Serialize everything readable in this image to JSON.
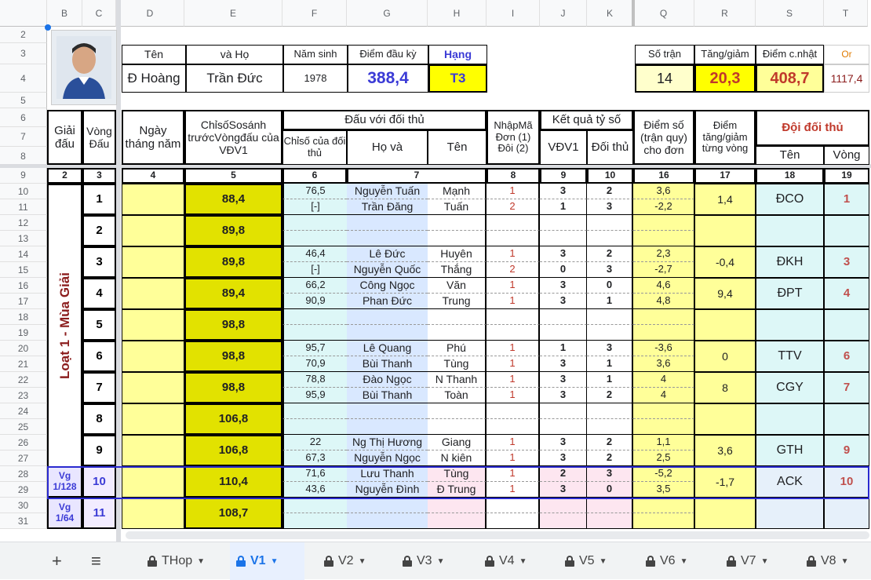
{
  "columns": [
    "B",
    "C",
    "D",
    "E",
    "F",
    "G",
    "H",
    "I",
    "J",
    "K",
    "Q",
    "R",
    "S",
    "T"
  ],
  "rows": [
    "2",
    "3",
    "4",
    "5",
    "6",
    "7",
    "8",
    "9",
    "10",
    "11",
    "12",
    "13",
    "14",
    "15",
    "16",
    "17",
    "18",
    "19",
    "20",
    "21",
    "22",
    "23",
    "24",
    "25",
    "26",
    "27",
    "28",
    "29",
    "30",
    "31"
  ],
  "profile": {
    "ten_label": "Tên",
    "va_label": "và",
    "ho_label": "Họ",
    "nam_sinh_label": "Năm sinh",
    "diem_dau_ky_label": "Điểm đầu kỳ",
    "hang_label": "Hạng",
    "ten": "Đ Hoàng",
    "ho": "Trần Đức",
    "nam_sinh": "1978",
    "diem_dau_ky": "388,4",
    "hang": "T3"
  },
  "summary": {
    "so_tran_label": "Số trận",
    "tang_giam_label": "Tăng/giảm",
    "diem_cnhat_label": "Điểm c.nhật",
    "or_label": "Or",
    "so_tran": "14",
    "tang_giam": "20,3",
    "diem_cnhat": "408,7",
    "or": "1117,4"
  },
  "headers": {
    "giai_dau": "Giải đấu",
    "vong_dau": "Vòng Đấu",
    "ngay": "Ngày tháng năm",
    "chiso": "ChỉsốSosánh trướcVòngđấu của VĐV1",
    "dau_voi": "Đấu với đối thủ",
    "chiso_doi_thu": "Chỉsố của đối thủ",
    "ho": "Họ",
    "va": "và",
    "ten": "Tên",
    "nhap_ma": "NhậpMã Đơn (1) Đôi (2)",
    "ket_qua": "Kết quả tỷ số",
    "vdv1": "VĐV1",
    "doi_thu": "Đối thủ",
    "diem_so": "Điểm số (trận quy) cho đơn",
    "diem_tang": "Điểm tăng/giảm từng vòng",
    "doi_doi_thu": "Đội đối thủ",
    "ten2": "Tên",
    "vong": "Vòng"
  },
  "col_numbers": [
    "2",
    "3",
    "4",
    "5",
    "6",
    "7",
    "8",
    "9",
    "10",
    "16",
    "17",
    "18",
    "19"
  ],
  "vertical_label": "Loạt 1 - Mùa Giải",
  "vg1": "Vg 1/128",
  "vg2": "Vg 1/64",
  "rounds": [
    {
      "vong": "1",
      "chiso": "88,4",
      "m": [
        {
          "cs": "76,5",
          "ho": "Nguyễn Tuấn",
          "ten": "Mạnh",
          "ma": "1",
          "a": "3",
          "b": "2",
          "d": "3,6"
        },
        {
          "cs": "[-]",
          "ho": "Trần Đăng",
          "ten": "Tuấn",
          "ma": "2",
          "a": "1",
          "b": "3",
          "d": "-2,2"
        }
      ],
      "tg": "1,4",
      "team": "ĐCO",
      "tv": "1"
    },
    {
      "vong": "2",
      "chiso": "89,8",
      "m": [],
      "tg": "",
      "team": "",
      "tv": ""
    },
    {
      "vong": "3",
      "chiso": "89,8",
      "m": [
        {
          "cs": "46,4",
          "ho": "Lê Đức",
          "ten": "Huyên",
          "ma": "1",
          "a": "3",
          "b": "2",
          "d": "2,3"
        },
        {
          "cs": "[-]",
          "ho": "Nguyễn Quốc",
          "ten": "Thắng",
          "ma": "2",
          "a": "0",
          "b": "3",
          "d": "-2,7"
        }
      ],
      "tg": "-0,4",
      "team": "ĐKH",
      "tv": "3"
    },
    {
      "vong": "4",
      "chiso": "89,4",
      "m": [
        {
          "cs": "66,2",
          "ho": "Công Ngọc",
          "ten": "Văn",
          "ma": "1",
          "a": "3",
          "b": "0",
          "d": "4,6"
        },
        {
          "cs": "90,9",
          "ho": "Phan Đức",
          "ten": "Trung",
          "ma": "1",
          "a": "3",
          "b": "1",
          "d": "4,8"
        }
      ],
      "tg": "9,4",
      "team": "ĐPT",
      "tv": "4"
    },
    {
      "vong": "5",
      "chiso": "98,8",
      "m": [],
      "tg": "",
      "team": "",
      "tv": ""
    },
    {
      "vong": "6",
      "chiso": "98,8",
      "m": [
        {
          "cs": "95,7",
          "ho": "Lê Quang",
          "ten": "Phú",
          "ma": "1",
          "a": "1",
          "b": "3",
          "d": "-3,6"
        },
        {
          "cs": "70,9",
          "ho": "Bùi Thanh",
          "ten": "Tùng",
          "ma": "1",
          "a": "3",
          "b": "1",
          "d": "3,6"
        }
      ],
      "tg": "0",
      "team": "TTV",
      "tv": "6"
    },
    {
      "vong": "7",
      "chiso": "98,8",
      "m": [
        {
          "cs": "78,8",
          "ho": "Đào Ngọc",
          "ten": "N Thanh",
          "ma": "1",
          "a": "3",
          "b": "1",
          "d": "4"
        },
        {
          "cs": "95,9",
          "ho": "Bùi Thanh",
          "ten": "Toàn",
          "ma": "1",
          "a": "3",
          "b": "2",
          "d": "4"
        }
      ],
      "tg": "8",
      "team": "CGY",
      "tv": "7"
    },
    {
      "vong": "8",
      "chiso": "106,8",
      "m": [],
      "tg": "",
      "team": "",
      "tv": ""
    },
    {
      "vong": "9",
      "chiso": "106,8",
      "m": [
        {
          "cs": "22",
          "ho": "Ng Thị Hương",
          "ten": "Giang",
          "ma": "1",
          "a": "3",
          "b": "2",
          "d": "1,1"
        },
        {
          "cs": "67,3",
          "ho": "Nguyễn Ngọc",
          "ten": "N kiên",
          "ma": "1",
          "a": "3",
          "b": "2",
          "d": "2,5"
        }
      ],
      "tg": "3,6",
      "team": "GTH",
      "tv": "9"
    },
    {
      "vong": "10",
      "chiso": "110,4",
      "m": [
        {
          "cs": "71,6",
          "ho": "Lưu Thanh",
          "ten": "Tùng",
          "ma": "1",
          "a": "2",
          "b": "3",
          "d": "-5,2"
        },
        {
          "cs": "43,6",
          "ho": "Nguyễn Đình",
          "ten": "Đ Trung",
          "ma": "1",
          "a": "3",
          "b": "0",
          "d": "3,5"
        }
      ],
      "tg": "-1,7",
      "team": "ACK",
      "tv": "10"
    },
    {
      "vong": "11",
      "chiso": "108,7",
      "m": [],
      "tg": "",
      "team": "",
      "tv": ""
    }
  ],
  "sheet_tabs": [
    "THop",
    "V1",
    "V2",
    "V3",
    "V4",
    "V5",
    "V6",
    "V7",
    "V8"
  ],
  "active_tab": "V1",
  "icons": {
    "add": "plus-icon",
    "menu": "menu-icon",
    "lock": "lock-icon"
  },
  "colors": {
    "accent": "#1a73e8",
    "yellow": "#ffff99",
    "olive": "#e2e200",
    "red": "#c0392b",
    "blue_text": "#3b3bd6"
  }
}
